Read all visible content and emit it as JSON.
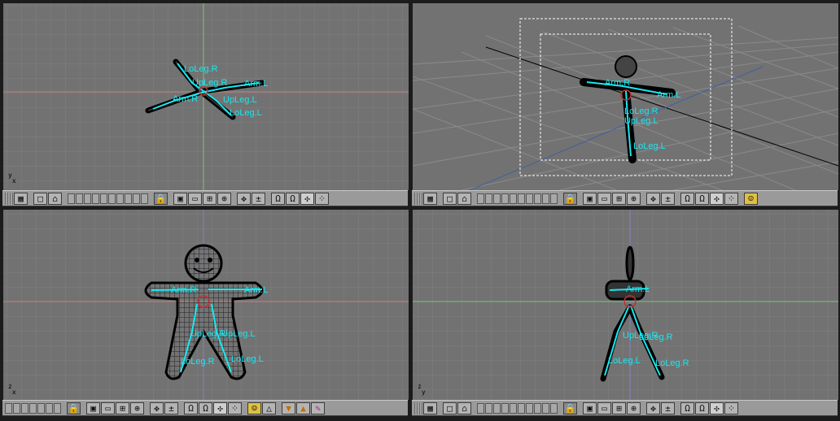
{
  "bones": {
    "loleg_r": "LoLeg.R",
    "upleg_r": "UpLeg.R",
    "arm_l": "Arm.L",
    "arm_r": "Arm.R",
    "upleg_l": "UpLeg.L",
    "loleg_l": "LoLeg.L"
  },
  "views": {
    "top": {
      "axis_v": "y",
      "axis_h": "x"
    },
    "front": {
      "axis_v": "z",
      "axis_h": "x"
    },
    "side": {
      "axis_v": "z",
      "axis_h": "y"
    }
  },
  "icons": {
    "grid": "▦",
    "view": "□",
    "home": "⌂",
    "lock": "🔒",
    "draw": "▣",
    "cube": "▭",
    "snap": "⊞",
    "globe": "⊕",
    "move": "✥",
    "pm": "±",
    "rot": "Ω",
    "pivot": "✣",
    "dots": "⁘",
    "smile": "☺",
    "tri": "△",
    "down": "▼",
    "up": "▲",
    "paint": "✎"
  }
}
